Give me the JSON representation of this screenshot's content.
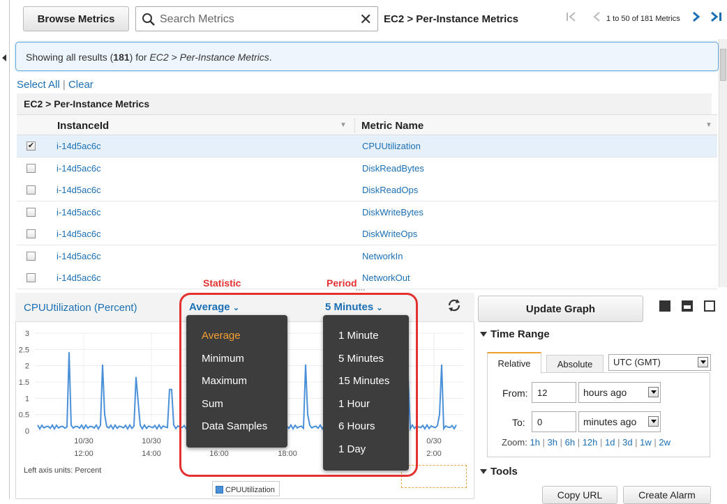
{
  "toolbar": {
    "browse_label": "Browse Metrics",
    "search_placeholder": "Search Metrics",
    "scope_label": "EC2 > Per-Instance Metrics",
    "pagination_text": "1 to 50 of 181 Metrics"
  },
  "banner": {
    "prefix": "Showing all results (",
    "count": "181",
    "middle": ") for ",
    "scope": "EC2 > Per-Instance Metrics",
    "suffix": "."
  },
  "selection": {
    "select_all": "Select All",
    "clear": "Clear",
    "separator": "|"
  },
  "table": {
    "group_title": "EC2 > Per-Instance Metrics",
    "columns": [
      "InstanceId",
      "Metric Name"
    ],
    "rows": [
      {
        "instance": "i-14d5ac6c",
        "metric": "CPUUtilization",
        "checked": true
      },
      {
        "instance": "i-14d5ac6c",
        "metric": "DiskReadBytes",
        "checked": false
      },
      {
        "instance": "i-14d5ac6c",
        "metric": "DiskReadOps",
        "checked": false
      },
      {
        "instance": "i-14d5ac6c",
        "metric": "DiskWriteBytes",
        "checked": false
      },
      {
        "instance": "i-14d5ac6c",
        "metric": "DiskWriteOps",
        "checked": false
      },
      {
        "instance": "i-14d5ac6c",
        "metric": "NetworkIn",
        "checked": false
      },
      {
        "instance": "i-14d5ac6c",
        "metric": "NetworkOut",
        "checked": false
      }
    ]
  },
  "graph": {
    "title": "CPUUtilization (Percent)",
    "statistic_value": "Average",
    "period_value": "5 Minutes",
    "axis_units": "Left axis units: Percent",
    "legend_label": "CPUUtilization",
    "series_color": "#4a90d9"
  },
  "chart_data": {
    "type": "line",
    "y_ticks": [
      "3",
      "2.5",
      "2",
      "1.5",
      "1",
      "0.5",
      "0"
    ],
    "ylim": [
      0,
      3
    ],
    "x_ticks": [
      {
        "date": "10/30",
        "time": "12:00"
      },
      {
        "date": "10/30",
        "time": "14:00"
      },
      {
        "date": "",
        "time": "16:00"
      },
      {
        "date": "",
        "time": "18:00"
      },
      {
        "date": "0/30",
        "time": "2:00"
      }
    ],
    "series": [
      {
        "name": "CPUUtilization",
        "pattern": "baseline ~0.1 with periodic spikes to ~2.3"
      }
    ],
    "grid": true
  },
  "statistic_menu": {
    "annotation": "Statistic",
    "options": [
      "Average",
      "Minimum",
      "Maximum",
      "Sum",
      "Data Samples"
    ],
    "active": "Average"
  },
  "period_menu": {
    "annotation": "Period",
    "options": [
      "1 Minute",
      "5 Minutes",
      "15 Minutes",
      "1 Hour",
      "6 Hours",
      "1 Day"
    ]
  },
  "side_panel": {
    "update_label": "Update Graph",
    "time_range_title": "Time Range",
    "tab_relative": "Relative",
    "tab_absolute": "Absolute",
    "timezone": "UTC (GMT)",
    "from_label": "From:",
    "from_value": "12",
    "from_unit": "hours ago",
    "to_label": "To:",
    "to_value": "0",
    "to_unit": "minutes ago",
    "zoom_label": "Zoom:",
    "zoom_options": [
      "1h",
      "3h",
      "6h",
      "12h",
      "1d",
      "3d",
      "1w",
      "2w"
    ],
    "tools_title": "Tools",
    "copy_url": "Copy URL",
    "create_alarm": "Create Alarm"
  },
  "colors": {
    "link": "#1a6fb5",
    "annotation": "#e53030",
    "menu_bg": "#3d3d3d",
    "menu_active": "#f5a033"
  }
}
